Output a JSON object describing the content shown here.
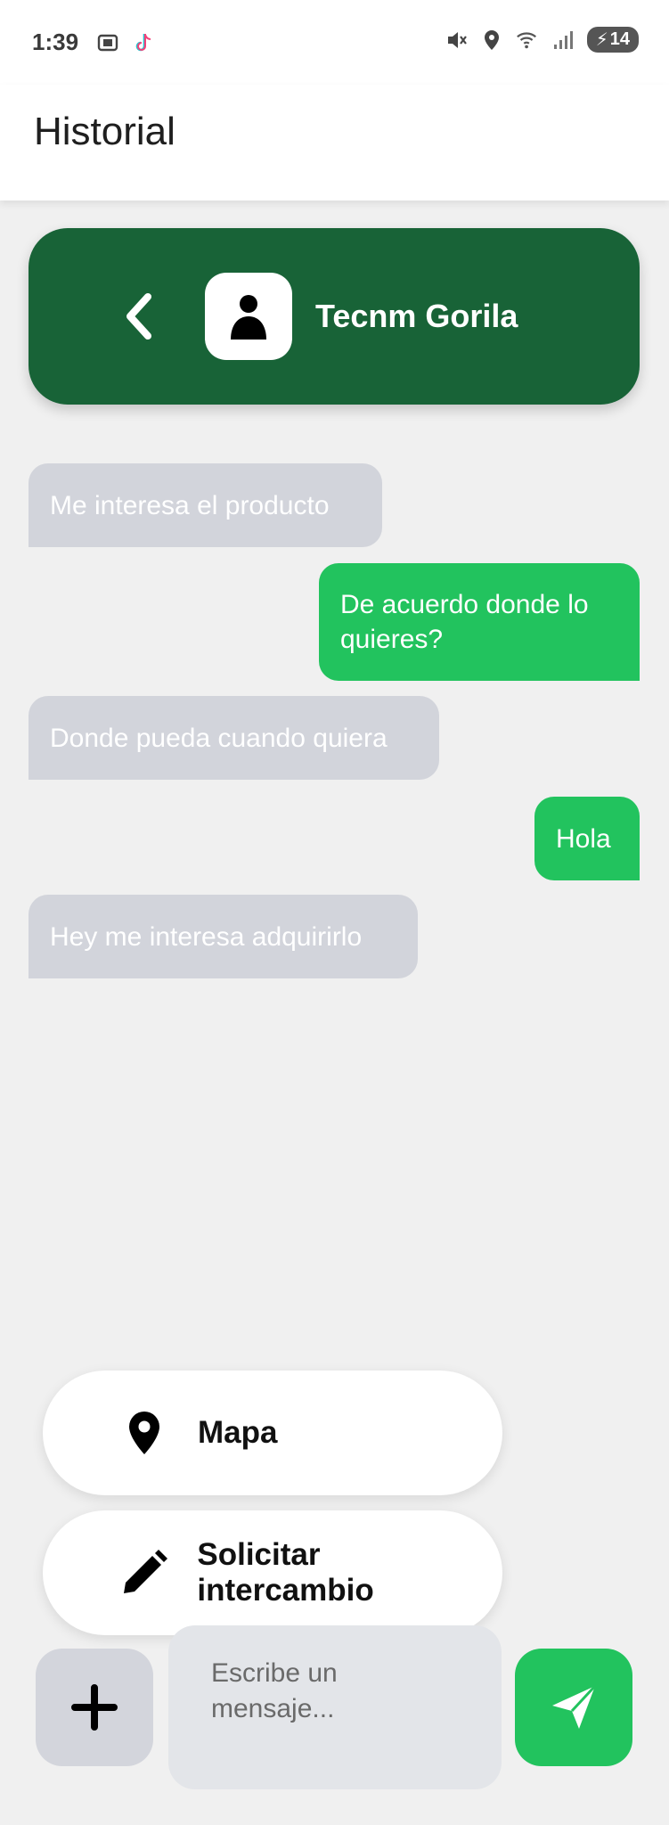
{
  "status_bar": {
    "time": "1:39",
    "battery": "14",
    "icons": [
      "screenshot-icon",
      "tiktok-icon",
      "mute-icon",
      "location-icon",
      "wifi-icon",
      "signal-icon",
      "battery-icon"
    ]
  },
  "app_bar": {
    "title": "Historial"
  },
  "chat_header": {
    "contact_name": "Tecnm Gorila",
    "back_icon": "chevron-left-icon",
    "avatar_icon": "person-icon"
  },
  "messages": [
    {
      "direction": "in",
      "text": "Me interesa el producto"
    },
    {
      "direction": "out",
      "text": "De acuerdo donde lo quieres?"
    },
    {
      "direction": "in",
      "text": "Donde pueda cuando quiera"
    },
    {
      "direction": "out",
      "text": "Hola"
    },
    {
      "direction": "in",
      "text": "Hey me interesa adquirirlo"
    }
  ],
  "action_menu": {
    "items": [
      {
        "label": "Mapa",
        "icon": "location-pin-icon"
      },
      {
        "label": "Solicitar intercambio",
        "icon": "pencil-icon"
      }
    ]
  },
  "composer": {
    "placeholder": "Escribe un mensaje...",
    "value": "",
    "plus_icon": "plus-icon",
    "send_icon": "send-icon"
  },
  "colors": {
    "header_green": "#186337",
    "accent_green": "#22c35e",
    "incoming_bubble": "#d2d4db",
    "background": "#f0f0f0"
  }
}
